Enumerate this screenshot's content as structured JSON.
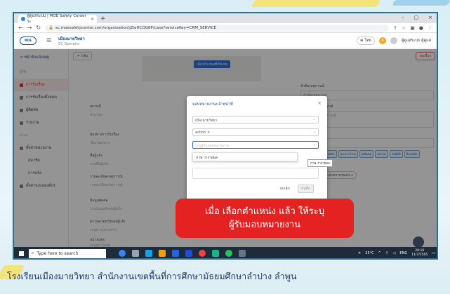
{
  "browser": {
    "tab_title": "ผู้ดูแลระบบ | MOE Safety Center ระ",
    "tab_close": "×",
    "new_tab": "+",
    "win_min": "–",
    "win_max": "▢",
    "win_close": "×",
    "url": "sc.moesafetycenter.com/organization/jZieHCQG8P/case?serviceKey=CRM_SERVICE"
  },
  "app": {
    "logo_text": "MOE",
    "org_name": "เมืองมายวิทยา",
    "org_sub": "SC Operator",
    "lang": "ไทย",
    "notif_count": "8",
    "user": "ผู้ดูแลระบบ ผู้ดูแล"
  },
  "sidebar": {
    "back": "< หน้ารับแจ้งเหตุ",
    "section1": "ผู้ใช้",
    "items": [
      {
        "label": "การรับเรื่อง",
        "active": true
      },
      {
        "label": "การรับเรื่องทั้งหมด"
      },
      {
        "label": "ผู้ติดต่อ"
      },
      {
        "label": "รายงาน"
      }
    ],
    "section2": "ระบบ",
    "settings": "ตั้งค่าหน่วยงาน",
    "sub1": "สมาชิก",
    "sub2": "การแจ้ง",
    "manage": "ตั้งค่าระบบองค์กร"
  },
  "main": {
    "back_btn": "← กลับ",
    "delete_btn": "ลบเรื่อง",
    "map_btn": "เลือกตำแหน่งที่เกิดเหตุ",
    "fields": [
      {
        "label": "สถานที่",
        "value": "ตำแหน่ง"
      },
      {
        "label": "ช่องทางการรับเรื่อง",
        "value": "เลือกช่องทาง"
      },
      {
        "label": "ชื่อผู้แจ้ง",
        "value": "ระบุชื่อผู้แจ้ง"
      },
      {
        "label": "รายละเอียดเหตุการณ์",
        "value": "รายละเอียดเหตุการณ์"
      },
      {
        "label": "ข้อมูลติดต่อ",
        "value": "ระบุข้อมูลติดต่อผู้แจ้ง"
      },
      {
        "label": "ความคาดหวังของผู้แจ้ง",
        "value": "ระบุความคาดหวัง"
      },
      {
        "label": "หมายเหตุ",
        "value": "ระบุหมายเหตุ"
      }
    ],
    "right": {
      "title_label": "หัวข้อเหตุการณ์",
      "title_value": "หัวข้อเหตุการณ์",
      "detail_label": "รายละเอียดเหตุการณ์",
      "detail_value": "รายละเอียดเหตุการณ์",
      "type_label": "ประเภท",
      "type_value": "เลือกประเภท",
      "chips": [
        "ความรุนแรง",
        "ยาเสพติด",
        "ทะเลาะวิวาท",
        "อุบัติเหตุ",
        "สุขภาพ",
        "ภัยพิบัติ",
        "สิ่งเสพติด",
        "ความปลอดภัย",
        "อื่นๆ"
      ],
      "sel1": "สถานะ ▾",
      "sel2": "ระดับความรุนแรง ▾"
    }
  },
  "modal": {
    "title": "มอบหมายงาน/เจ้าหน้าที่",
    "close": "×",
    "field1": "เมืองมายวิทยา",
    "field2": "action ×",
    "field3_placeholder": "ระบุผู้รับมอบหมายงาน",
    "option": "ภาษ ว่าง่ายผล",
    "tooltip": "ภาษ ว่าง่ายผล",
    "cancel": "ยกเลิก",
    "save": "บันทึก"
  },
  "callout": {
    "line1": "เมื่อ เลือกตำแหน่ง แล้ว ให้ระบุ",
    "line2": "ผู้รับมอบหมายงาน"
  },
  "taskbar": {
    "search_placeholder": "Type here to search",
    "temp": "25°C",
    "lang": "ENG",
    "time": "20:16",
    "date": "11/7/2565"
  },
  "caption": "โรงเรียนเมืองมายวิทยา  สำนักงานเขตพื้นที่การศึกษามัธยมศึกษาลำปาง  ลำพูน"
}
